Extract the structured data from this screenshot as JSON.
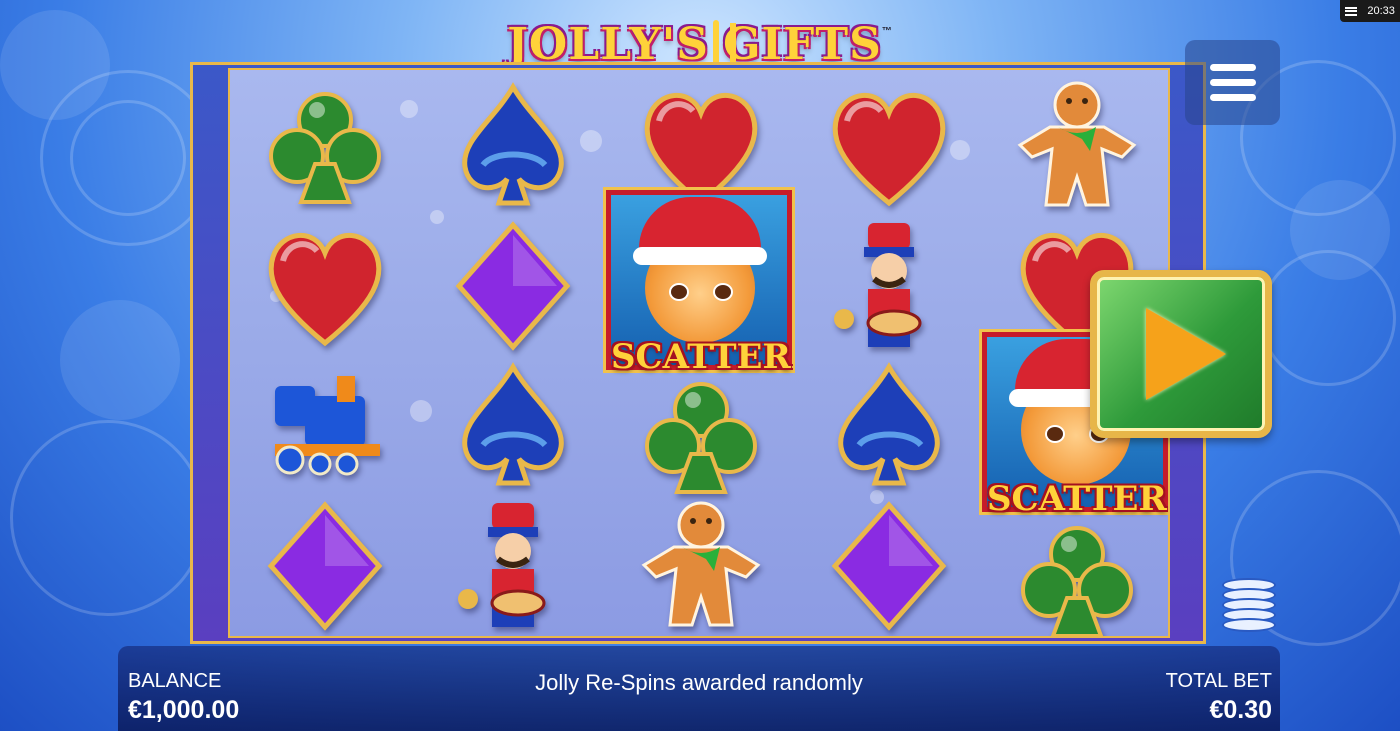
{
  "status": {
    "clock": "20:33",
    "menu_icon": "list-icon"
  },
  "logo": {
    "text_left": "JOLLY'S",
    "text_right": "GIFTS",
    "tm": "™"
  },
  "reels": {
    "columns": [
      [
        "club",
        "heart",
        "toy-train",
        "diamond"
      ],
      [
        "spade",
        "diamond",
        "spade",
        "nutcracker"
      ],
      [
        "heart",
        "scatter",
        "club",
        "gingerbread"
      ],
      [
        "heart",
        "nutcracker",
        "spade",
        "diamond"
      ],
      [
        "gingerbread",
        "heart",
        "scatter",
        "club"
      ]
    ],
    "scatter_label": "SCATTER"
  },
  "controls": {
    "menu_icon": "hamburger-menu-icon",
    "spin_icon": "play-icon",
    "bet_icon": "coin-stack-icon"
  },
  "bottom_bar": {
    "balance_label": "BALANCE",
    "balance_value": "€1,000.00",
    "message": "Jolly Re-Spins awarded randomly",
    "total_bet_label": "TOTAL BET",
    "total_bet_value": "€0.30"
  },
  "colors": {
    "gold": "#e9b84a",
    "heart": "#d0242e",
    "spade": "#1d3fb8",
    "club": "#2c8a2f",
    "diamond": "#8a2be2",
    "spin": "#2e9a3a"
  }
}
